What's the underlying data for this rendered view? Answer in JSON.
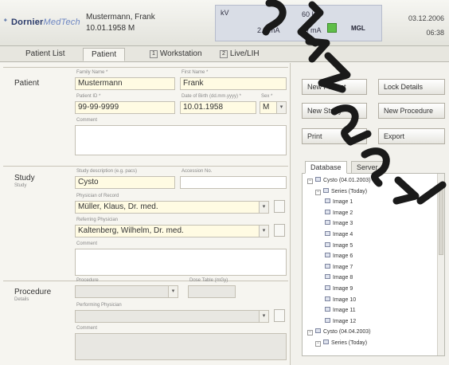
{
  "header": {
    "logo_prefix": "Dornier",
    "logo_suffix": "MedTech",
    "patient_name": "Mustermann, Frank",
    "patient_dob": "10.01.1958   M",
    "status": {
      "kv_label": "kV",
      "kv_value": "60 kV",
      "ma_value": "2.0 mA",
      "mas_value": "4.0 mA",
      "mode": "MGL"
    },
    "date": "03.12.2006",
    "time": "06:38"
  },
  "tabs": [
    {
      "label": "Patient List"
    },
    {
      "label": "Patient"
    },
    {
      "key": "1",
      "label": "Workstation"
    },
    {
      "key": "2",
      "label": "Live/LIH"
    }
  ],
  "patient_section": {
    "title": "Patient",
    "family_name_label": "Family Name *",
    "family_name": "Mustermann",
    "first_name_label": "First Name *",
    "first_name": "Frank",
    "patient_id_label": "Patient ID *",
    "patient_id": "99-99-9999",
    "dob_label": "Date of Birth (dd.mm.yyyy) *",
    "dob": "10.01.1958",
    "sex_label": "Sex *",
    "sex": "M",
    "comment_label": "Comment"
  },
  "study_section": {
    "title": "Study",
    "subtitle": "Study",
    "description_label": "Study description (e.g. pacs)",
    "description": "Cysto",
    "accession_label": "Accession No.",
    "physician_label": "Physician of Record",
    "physician": "Müller, Klaus, Dr. med.",
    "referring_label": "Referring Physician",
    "referring": "Kaltenberg, Wilhelm, Dr. med.",
    "comment_label": "Comment"
  },
  "procedure_section": {
    "title": "Procedure",
    "subtitle": "Details",
    "procedure_label": "Procedure",
    "dose_label": "Dose Table (mGy)",
    "performing_label": "Performing Physician",
    "comment_label": "Comment"
  },
  "actions": {
    "new_patient": "New Patient",
    "lock_details": "Lock Details",
    "new_study": "New Study",
    "new_procedure": "New Procedure",
    "print": "Print",
    "export": "Export"
  },
  "subtabs": [
    "Database",
    "Server"
  ],
  "tree": [
    {
      "label": "Cysto (04.01.2003)",
      "level": 0,
      "type": "study"
    },
    {
      "label": "Series (Today)",
      "level": 1,
      "type": "series"
    },
    {
      "label": "Image 1",
      "level": 2,
      "type": "image"
    },
    {
      "label": "Image 2",
      "level": 2,
      "type": "image"
    },
    {
      "label": "Image 3",
      "level": 2,
      "type": "image"
    },
    {
      "label": "Image 4",
      "level": 2,
      "type": "image"
    },
    {
      "label": "Image 5",
      "level": 2,
      "type": "image"
    },
    {
      "label": "Image 6",
      "level": 2,
      "type": "image"
    },
    {
      "label": "Image 7",
      "level": 2,
      "type": "image"
    },
    {
      "label": "Image 8",
      "level": 2,
      "type": "image"
    },
    {
      "label": "Image 9",
      "level": 2,
      "type": "image"
    },
    {
      "label": "Image 10",
      "level": 2,
      "type": "image"
    },
    {
      "label": "Image 11",
      "level": 2,
      "type": "image"
    },
    {
      "label": "Image 12",
      "level": 2,
      "type": "image"
    },
    {
      "label": "Cysto (04.04.2003)",
      "level": 0,
      "type": "study"
    },
    {
      "label": "Series (Today)",
      "level": 1,
      "type": "series"
    }
  ],
  "colors": {
    "required_field": "#fffbe3",
    "status_led": "#5fbe48",
    "overlay_mark": "#1a1a1a"
  }
}
